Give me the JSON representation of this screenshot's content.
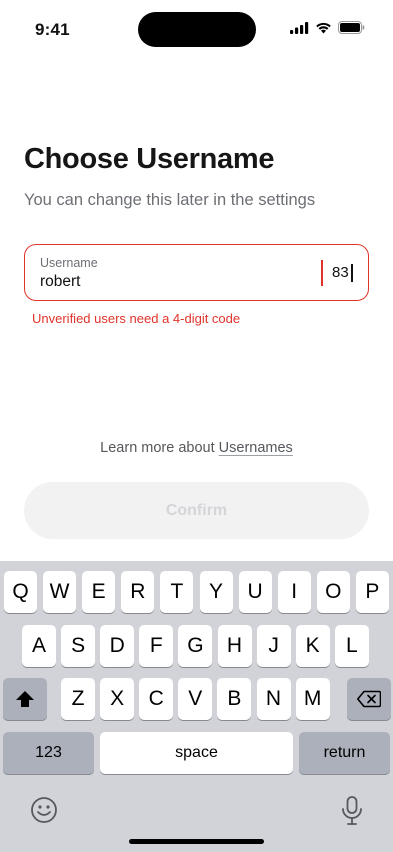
{
  "status_bar": {
    "time": "9:41"
  },
  "screen": {
    "title": "Choose Username",
    "subtitle": "You can change this later in the settings",
    "username_field": {
      "label": "Username",
      "value": "robert",
      "suffix": "83"
    },
    "error_message": "Unverified users need a 4-digit code",
    "learn_more": {
      "prefix": "Learn more about ",
      "link": "Usernames"
    },
    "confirm_label": "Confirm"
  },
  "keyboard": {
    "row1": [
      "Q",
      "W",
      "E",
      "R",
      "T",
      "Y",
      "U",
      "I",
      "O",
      "P"
    ],
    "row2": [
      "A",
      "S",
      "D",
      "F",
      "G",
      "H",
      "J",
      "K",
      "L"
    ],
    "row3": [
      "Z",
      "X",
      "C",
      "V",
      "B",
      "N",
      "M"
    ],
    "numbers_label": "123",
    "space_label": "space",
    "return_label": "return",
    "icons": {
      "shift": "shift-icon",
      "delete": "backspace-icon",
      "emoji": "emoji-icon",
      "dictation": "microphone-icon"
    }
  },
  "colors": {
    "error": "#e0342a",
    "keyboard_bg": "#d1d3d9"
  }
}
